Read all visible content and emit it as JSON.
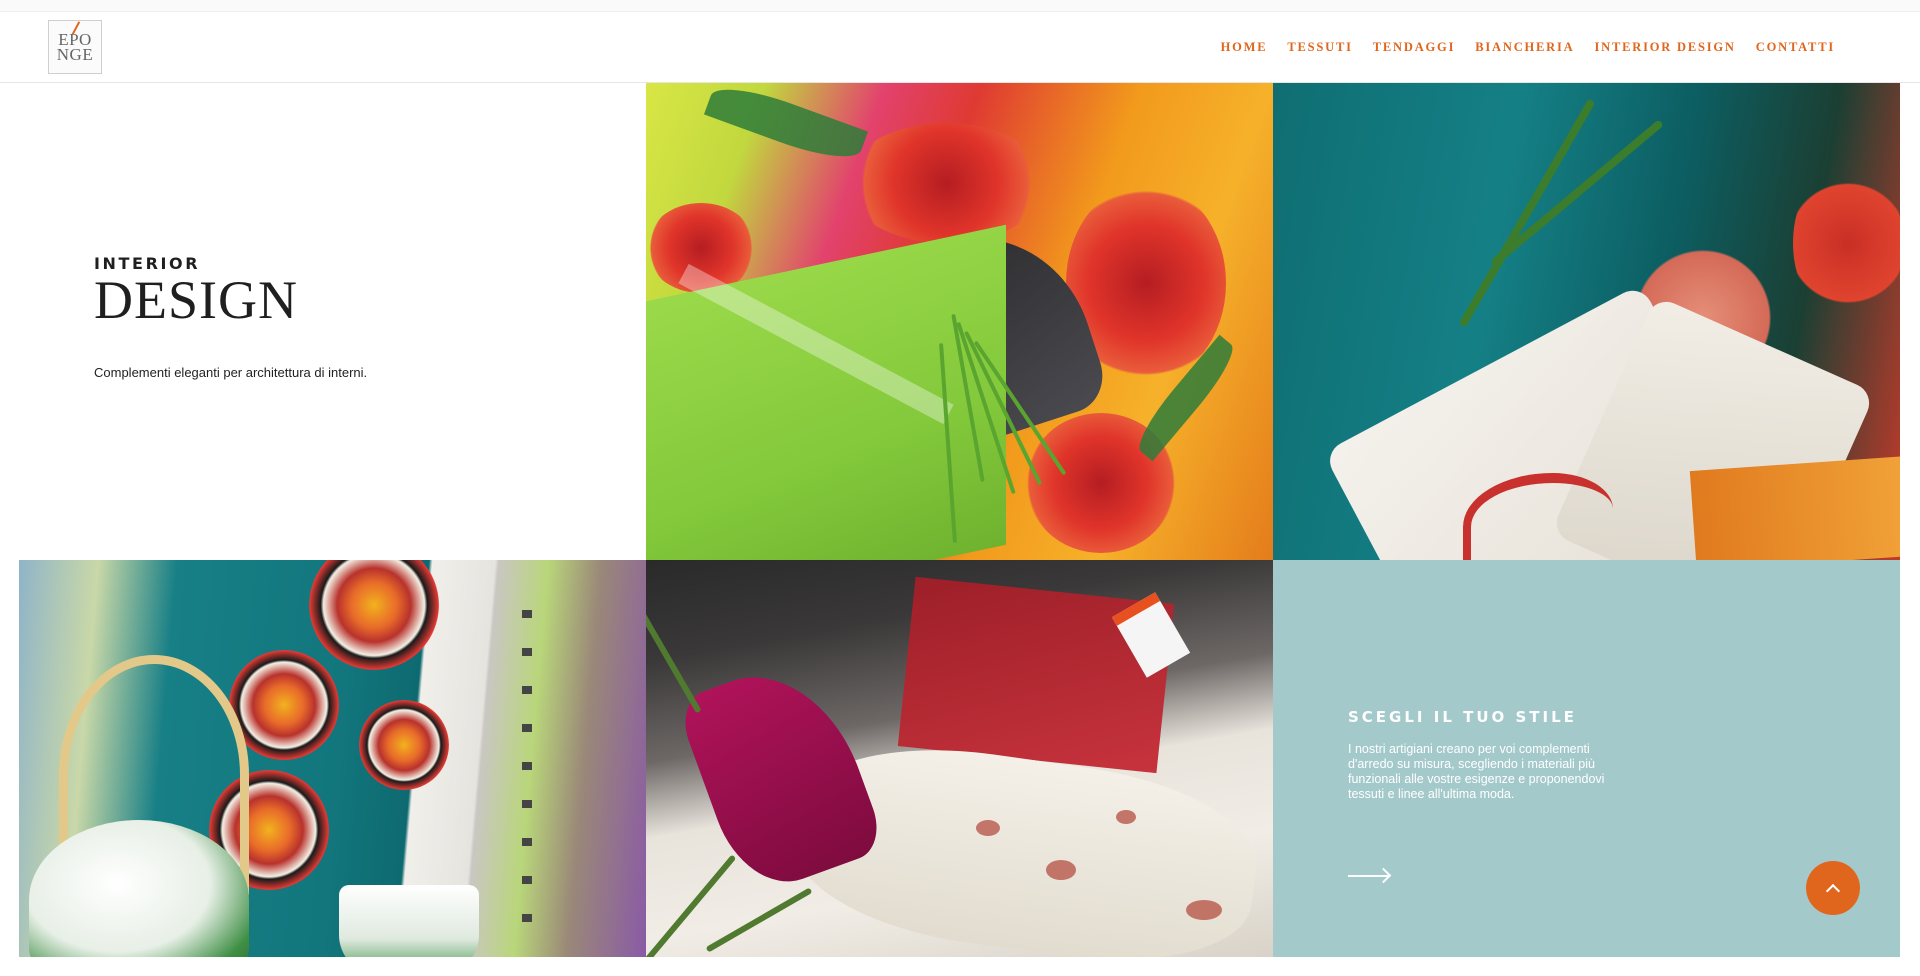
{
  "brand": {
    "logo_line1": "EPO",
    "logo_line2": "NGE",
    "accent": "#e0661d"
  },
  "nav": {
    "items": [
      {
        "label": "HOME"
      },
      {
        "label": "TESSUTI"
      },
      {
        "label": "TENDAGGI"
      },
      {
        "label": "BIANCHERIA"
      },
      {
        "label": "INTERIOR DESIGN"
      },
      {
        "label": "CONTATTI"
      }
    ]
  },
  "hero": {
    "kicker": "INTERIOR",
    "title": "DESIGN",
    "description": "Complementi eleganti per architettura di interni."
  },
  "panel": {
    "title": "SCEGLI IL TUO STILE",
    "text": "I nostri artigiani creano per voi complementi d'arredo su misura, scegliendo i materiali più funzionali alle vostre esigenze e proponendovi tessuti e linee all'ultima moda.",
    "background": "#a3c9cb"
  },
  "icons": {
    "arrow": "arrow-right-icon",
    "back_to_top": "chevron-up-icon"
  }
}
